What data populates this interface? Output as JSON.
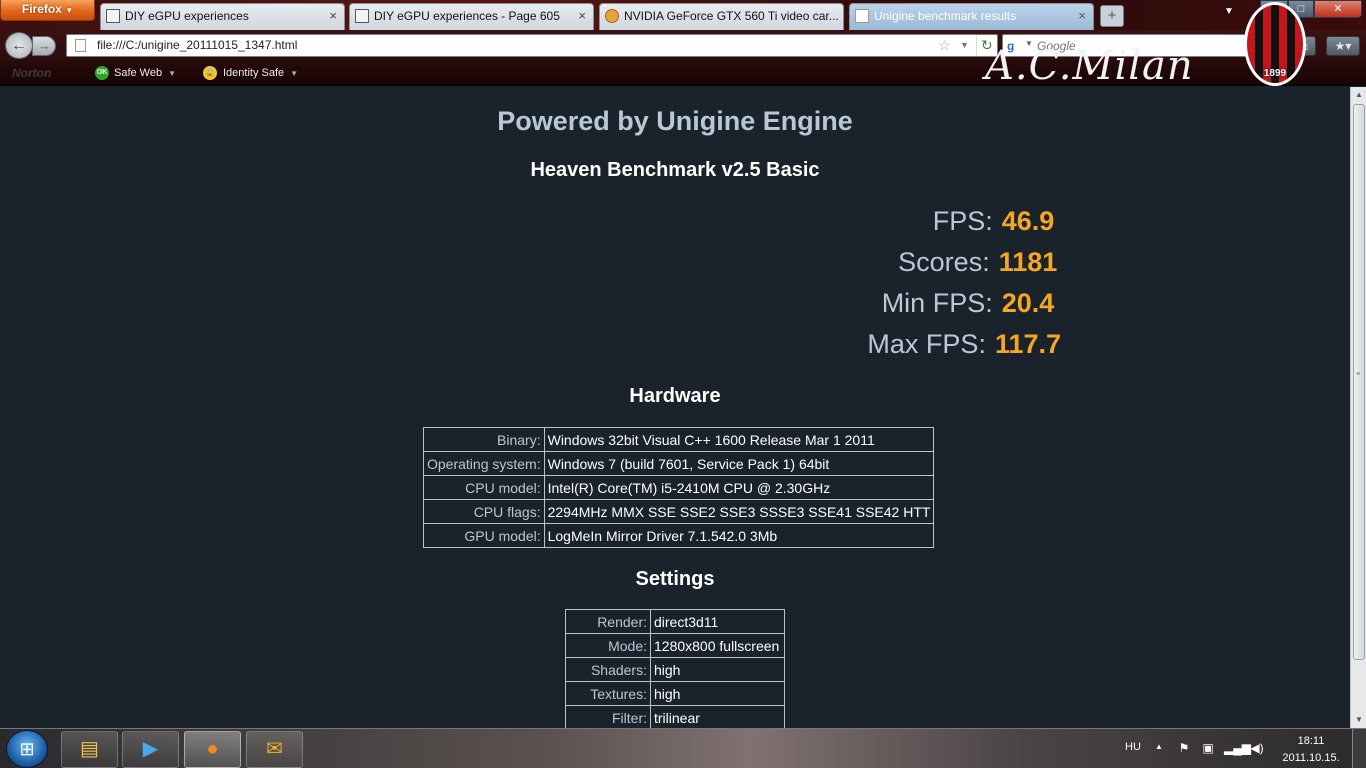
{
  "browser": {
    "menu_label": "Firefox",
    "tabs": [
      {
        "title": "DIY eGPU experiences",
        "active": false
      },
      {
        "title": "DIY eGPU experiences - Page 605",
        "active": false
      },
      {
        "title": "NVIDIA GeForce GTX 560 Ti video car...",
        "active": false
      },
      {
        "title": "Unigine benchmark results",
        "active": true
      }
    ],
    "tab_close": "×",
    "new_tab": "+",
    "window_controls": {
      "minimize": "–",
      "maximize": "□",
      "close": "✕"
    },
    "url": "file:///C:/unigine_20111015_1347.html",
    "search_placeholder": "Google"
  },
  "norton_toolbar": {
    "logo": "Norton",
    "safe_web": "Safe Web",
    "safe_web_badge": "OK",
    "identity_safe": "Identity Safe"
  },
  "theme_decoration": {
    "text": "A.C.Milan",
    "crest_year": "1899"
  },
  "page": {
    "powered_by": "Powered by Unigine Engine",
    "benchmark_title": "Heaven Benchmark v2.5 Basic",
    "stats": [
      {
        "label": "FPS:",
        "value": "46.9"
      },
      {
        "label": "Scores:",
        "value": "1181"
      },
      {
        "label": "Min FPS:",
        "value": "20.4"
      },
      {
        "label": "Max FPS:",
        "value": "117.7"
      }
    ],
    "hardware_heading": "Hardware",
    "hardware": [
      {
        "key": "Binary:",
        "value": "Windows 32bit Visual C++ 1600 Release Mar 1 2011"
      },
      {
        "key": "Operating system:",
        "value": "Windows 7 (build 7601, Service Pack 1) 64bit"
      },
      {
        "key": "CPU model:",
        "value": "Intel(R) Core(TM) i5-2410M CPU @ 2.30GHz"
      },
      {
        "key": "CPU flags:",
        "value": "2294MHz MMX SSE SSE2 SSE3 SSSE3 SSE41 SSE42 HTT"
      },
      {
        "key": "GPU model:",
        "value": "LogMeIn Mirror Driver 7.1.542.0 3Mb"
      }
    ],
    "settings_heading": "Settings",
    "settings": [
      {
        "key": "Render:",
        "value": "direct3d11"
      },
      {
        "key": "Mode:",
        "value": "1280x800 fullscreen"
      },
      {
        "key": "Shaders:",
        "value": "high"
      },
      {
        "key": "Textures:",
        "value": "high"
      },
      {
        "key": "Filter:",
        "value": "trilinear"
      }
    ]
  },
  "taskbar": {
    "language": "HU",
    "time": "18:11",
    "date": "2011.10.15."
  },
  "colors": {
    "page_background": "#1a232b",
    "label_color": "#b8c8d4",
    "value_accent": "#f5a623"
  }
}
